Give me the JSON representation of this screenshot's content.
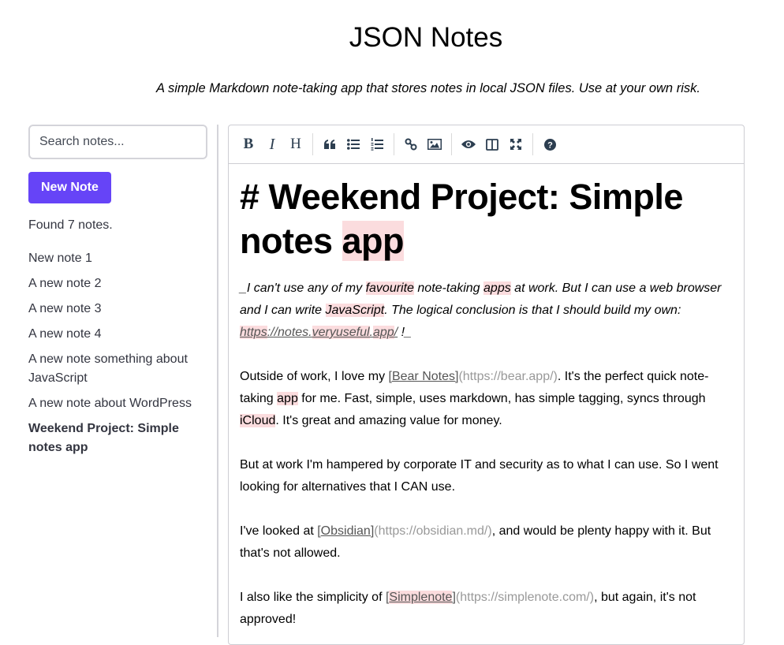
{
  "header": {
    "title": "JSON Notes",
    "tagline": "A simple Markdown note-taking app that stores notes in local JSON files. Use at your own risk."
  },
  "sidebar": {
    "search_placeholder": "Search notes...",
    "search_value": "",
    "new_note_label": "New Note",
    "found_text": "Found 7 notes.",
    "notes": [
      {
        "title": "New note 1",
        "active": false
      },
      {
        "title": "A new note 2",
        "active": false
      },
      {
        "title": "A new note 3",
        "active": false
      },
      {
        "title": "A new note 4",
        "active": false
      },
      {
        "title": "A new note something about JavaScript",
        "active": false
      },
      {
        "title": "A new note about WordPress",
        "active": false
      },
      {
        "title": "Weekend Project: Simple notes app",
        "active": true
      }
    ]
  },
  "toolbar": {
    "buttons": [
      {
        "name": "bold",
        "icon": "bold-icon"
      },
      {
        "name": "italic",
        "icon": "italic-icon"
      },
      {
        "name": "heading",
        "icon": "heading-icon"
      },
      {
        "name": "quote",
        "icon": "quote-icon"
      },
      {
        "name": "unordered-list",
        "icon": "unordered-list-icon"
      },
      {
        "name": "ordered-list",
        "icon": "ordered-list-icon"
      },
      {
        "name": "link",
        "icon": "link-icon"
      },
      {
        "name": "image",
        "icon": "image-icon"
      },
      {
        "name": "preview",
        "icon": "eye-icon"
      },
      {
        "name": "side-by-side",
        "icon": "columns-icon"
      },
      {
        "name": "fullscreen",
        "icon": "fullscreen-icon"
      },
      {
        "name": "guide",
        "icon": "help-icon"
      }
    ]
  },
  "editor": {
    "heading": {
      "hash": "# ",
      "text_before": "Weekend Project: Simple notes ",
      "misspelled": "app"
    },
    "intro": {
      "p1": "_I can't use any of my ",
      "w1": "favourite",
      "p2": " note-taking ",
      "w2": "apps",
      "p3": " at work. But I can use a web browser and I can write ",
      "w3": "JavaScript",
      "p4": ". The logical conclusion is that I should build my own: ",
      "link_a": "https",
      "link_b": "://notes.",
      "link_c": "veryuseful",
      "link_d": ".",
      "link_e": "app",
      "link_f": "/",
      "p5": " !_"
    },
    "para2": {
      "p1": "Outside of work, I love my ",
      "link": "[Bear Notes]",
      "url": "(https://bear.app/)",
      "p2": ". It's the perfect quick note-taking ",
      "w1": "app",
      "p3": " for me.  Fast, simple, uses markdown, has simple tagging, syncs through ",
      "w2": "iCloud",
      "p4": ". It's great and amazing value for money."
    },
    "para3": "But at work I'm hampered by corporate IT and security as to what I can use. So I went looking for alternatives that I CAN use.",
    "para4": {
      "p1": "I've looked at ",
      "link": "[Obsidian]",
      "url": "(https://obsidian.md/)",
      "p2": ", and would be plenty happy with it. But that's not allowed."
    },
    "para5": {
      "p1": "I also like the simplicity of ",
      "link_open": "[",
      "link_word": "Simplenote",
      "link_close": "]",
      "url": "(https://simplenote.com/)",
      "p2": ", but again, it's not approved!"
    }
  }
}
